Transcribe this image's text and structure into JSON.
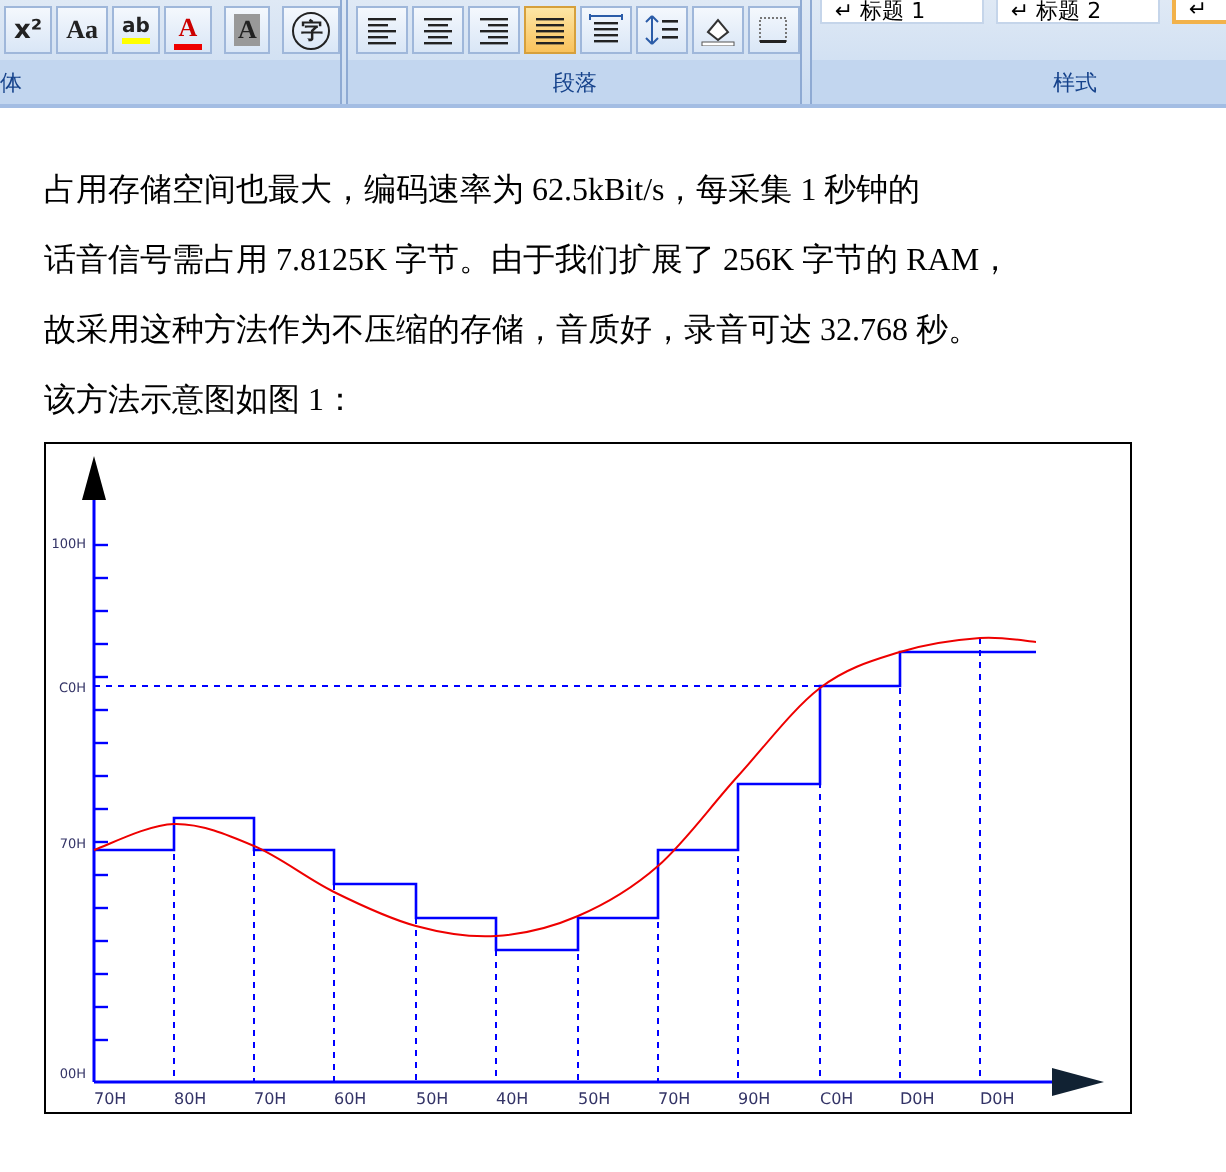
{
  "ribbon": {
    "font_group": {
      "label": "体",
      "buttons": [
        {
          "kind": "superscript",
          "glyph": "x²"
        },
        {
          "kind": "change-case",
          "glyph": "Aa"
        },
        {
          "kind": "highlight",
          "glyph": "ab"
        },
        {
          "kind": "font-color",
          "glyph": "A"
        },
        {
          "kind": "char-shading",
          "glyph": "A"
        },
        {
          "kind": "enclose",
          "glyph": "字"
        }
      ]
    },
    "paragraph_group": {
      "label": "段落",
      "buttons": [
        {
          "kind": "align-left",
          "selected": false
        },
        {
          "kind": "align-center",
          "selected": false
        },
        {
          "kind": "align-right",
          "selected": false
        },
        {
          "kind": "justify",
          "selected": true
        },
        {
          "kind": "distribute",
          "selected": false
        },
        {
          "kind": "line-spacing",
          "selected": false
        },
        {
          "kind": "shading",
          "selected": false
        },
        {
          "kind": "borders",
          "selected": false
        }
      ]
    },
    "styles_group": {
      "label": "样式",
      "styles": [
        {
          "label": "↵ 标题 1",
          "selected": false
        },
        {
          "label": "↵ 标题 2",
          "selected": false
        },
        {
          "label": "↵",
          "selected": true
        }
      ]
    }
  },
  "document": {
    "lines": [
      "占用存储空间也最大，编码速率为 62.5kBit/s，每采集 1 秒钟的",
      "话音信号需占用 7.8125K 字节。由于我们扩展了 256K 字节的 RAM，",
      "故采用这种方法作为不压缩的存储，音质好，录音可达 32.768 秒。",
      "该方法示意图如图 1："
    ],
    "figure": {
      "y_labels": [
        "100H",
        "C0H",
        "70H",
        "00H"
      ],
      "x_labels": [
        "70H",
        "80H",
        "70H",
        "60H",
        "50H",
        "40H",
        "50H",
        "70H",
        "90H",
        "C0H",
        "D0H",
        "D0H"
      ]
    }
  }
}
